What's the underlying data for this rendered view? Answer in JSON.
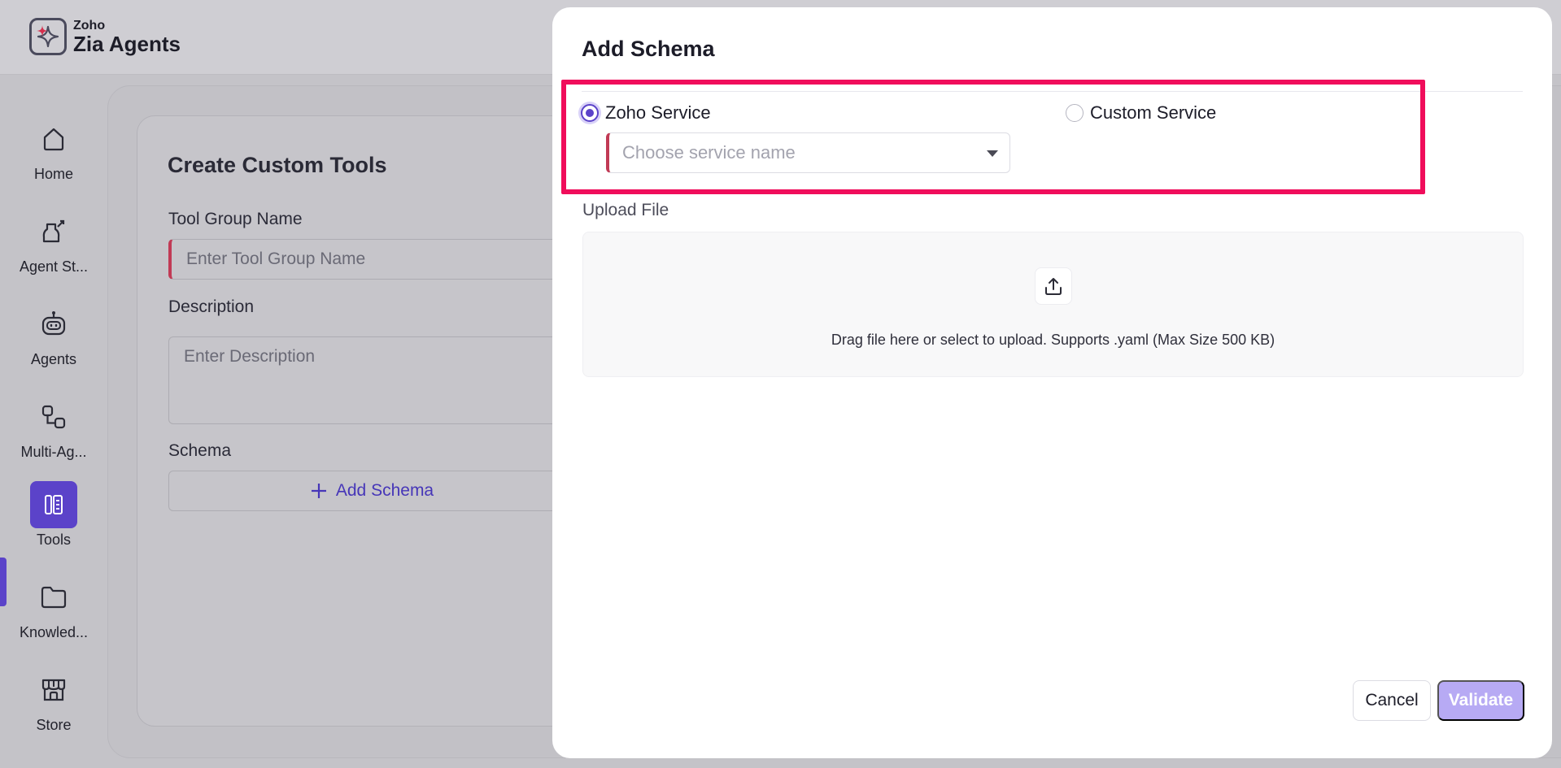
{
  "app": {
    "brand_small": "Zoho",
    "brand_name": "Zia Agents"
  },
  "sidebar": {
    "items": [
      {
        "label": "Home",
        "icon": "home-icon"
      },
      {
        "label": "Agent St...",
        "icon": "agent-studio-icon"
      },
      {
        "label": "Agents",
        "icon": "robot-icon"
      },
      {
        "label": "Multi-Ag...",
        "icon": "multi-agent-icon"
      },
      {
        "label": "Tools",
        "icon": "tools-icon",
        "active": true
      },
      {
        "label": "Knowled...",
        "icon": "folder-icon"
      },
      {
        "label": "Store",
        "icon": "store-icon"
      }
    ]
  },
  "form": {
    "title": "Create Custom Tools",
    "tool_group_label": "Tool Group Name",
    "tool_group_placeholder": "Enter Tool Group Name",
    "description_label": "Description",
    "description_placeholder": "Enter Description",
    "schema_label": "Schema",
    "add_schema_label": "Add Schema"
  },
  "modal": {
    "title": "Add Schema",
    "options": {
      "zoho_service": "Zoho Service",
      "custom_service": "Custom Service",
      "selected": "Zoho Service"
    },
    "service_select_placeholder": "Choose service name",
    "upload_label": "Upload File",
    "upload_hint": "Drag file here or select to upload. Supports .yaml (Max Size 500 KB)",
    "cancel_label": "Cancel",
    "validate_label": "Validate"
  },
  "colors": {
    "accent": "#5b43c9",
    "highlight": "#f00d5b",
    "required": "#c13a55",
    "validate_disabled": "#b7aaf4"
  }
}
